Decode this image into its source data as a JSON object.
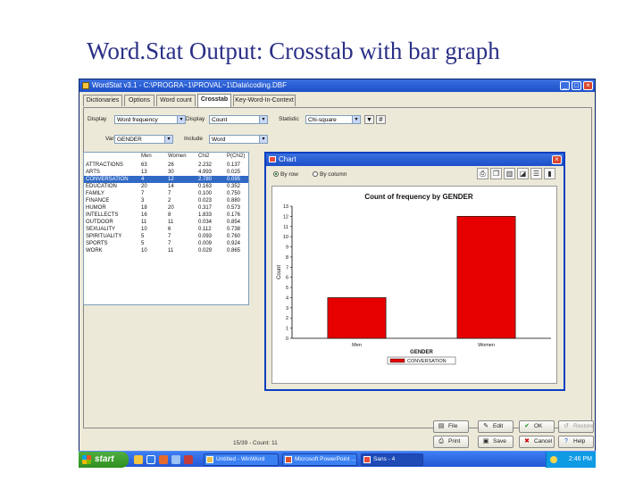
{
  "slide": {
    "title": "Word.Stat Output:  Crosstab with bar graph"
  },
  "app": {
    "title": "WordStat v3.1 - C:\\PROGRA~1\\PROVAL~1\\Data\\coding.DBF",
    "tabs": [
      "Dictionaries",
      "Options",
      "Word count",
      "Crosstab",
      "Key-Word-In-Context"
    ],
    "active_tab": "Crosstab"
  },
  "controls": {
    "display_label": "Display",
    "display_value": "Word frequency",
    "display2_label": "Display",
    "display2_value": "Count",
    "statistic_label": "Statistic",
    "statistic_value": "Chi-square",
    "vars_label": "Vars",
    "vars_value": "GENDER",
    "include_label": "Include",
    "include_value": "Word"
  },
  "table": {
    "columns": [
      "",
      "Men",
      "Women",
      "Chi2",
      "P(Chi2)"
    ],
    "rows": [
      [
        "ATTRACTIONS",
        "63",
        "26",
        "2.232",
        "0.137"
      ],
      [
        "ARTS",
        "13",
        "30",
        "4.993",
        "0.025"
      ],
      [
        "CONVERSATION",
        "4",
        "12",
        "2.780",
        "0.095"
      ],
      [
        "EDUCATION",
        "20",
        "14",
        "0.163",
        "0.352"
      ],
      [
        "FAMILY",
        "7",
        "7",
        "0.100",
        "0.750"
      ],
      [
        "FINANCE",
        "3",
        "2",
        "0.023",
        "0.880"
      ],
      [
        "HUMOR",
        "18",
        "20",
        "0.317",
        "0.573"
      ],
      [
        "INTELLECTS",
        "16",
        "8",
        "1.833",
        "0.176"
      ],
      [
        "OUTDOOR",
        "11",
        "11",
        "0.034",
        "0.854"
      ],
      [
        "SEXUALITY",
        "10",
        "6",
        "0.112",
        "0.738"
      ],
      [
        "SPIRITUALITY",
        "5",
        "7",
        "0.093",
        "0.760"
      ],
      [
        "SPORTS",
        "5",
        "7",
        "0.009",
        "0.924"
      ],
      [
        "WORK",
        "10",
        "11",
        "0.029",
        "0.865"
      ]
    ],
    "selected_row": 2
  },
  "chart_dialog": {
    "title": "Chart",
    "radio_row": "By row",
    "radio_col": "By column",
    "tool_icons": [
      "print-icon",
      "copy-icon",
      "chart-type-icon",
      "3d-icon",
      "legend-icon",
      "bar-icon"
    ]
  },
  "chart_data": {
    "type": "bar",
    "title": "Count of frequency by GENDER",
    "xlabel": "GENDER",
    "ylabel": "Count",
    "categories": [
      "Men",
      "Women"
    ],
    "values": [
      4,
      12
    ],
    "ylim": [
      0,
      13
    ],
    "yticks": [
      0,
      1,
      2,
      3,
      4,
      5,
      6,
      7,
      8,
      9,
      10,
      11,
      12,
      13
    ],
    "legend": "CONVERSATION",
    "legend_position": "bottom",
    "bar_color": "#e60000",
    "grid": false
  },
  "buttons": [
    {
      "label": "File",
      "icon": "file-icon",
      "disabled": false
    },
    {
      "label": "Edit",
      "icon": "edit-icon",
      "disabled": false
    },
    {
      "label": "OK",
      "icon": "check-icon",
      "disabled": false
    },
    {
      "label": "Restore",
      "icon": "restore-icon",
      "disabled": true
    },
    {
      "label": "Print",
      "icon": "print-icon",
      "disabled": false
    },
    {
      "label": "Save",
      "icon": "save-icon",
      "disabled": false
    },
    {
      "label": "Cancel",
      "icon": "cancel-icon",
      "disabled": false
    },
    {
      "label": "Help",
      "icon": "help-icon",
      "disabled": false
    }
  ],
  "status": {
    "text": "15/39 - Count: 11"
  },
  "taskbar": {
    "start": "start",
    "items": [
      "Untitled - WinWord",
      "Microsoft PowerPoint ...",
      "Sans - 4"
    ],
    "clock": "2:46 PM"
  }
}
